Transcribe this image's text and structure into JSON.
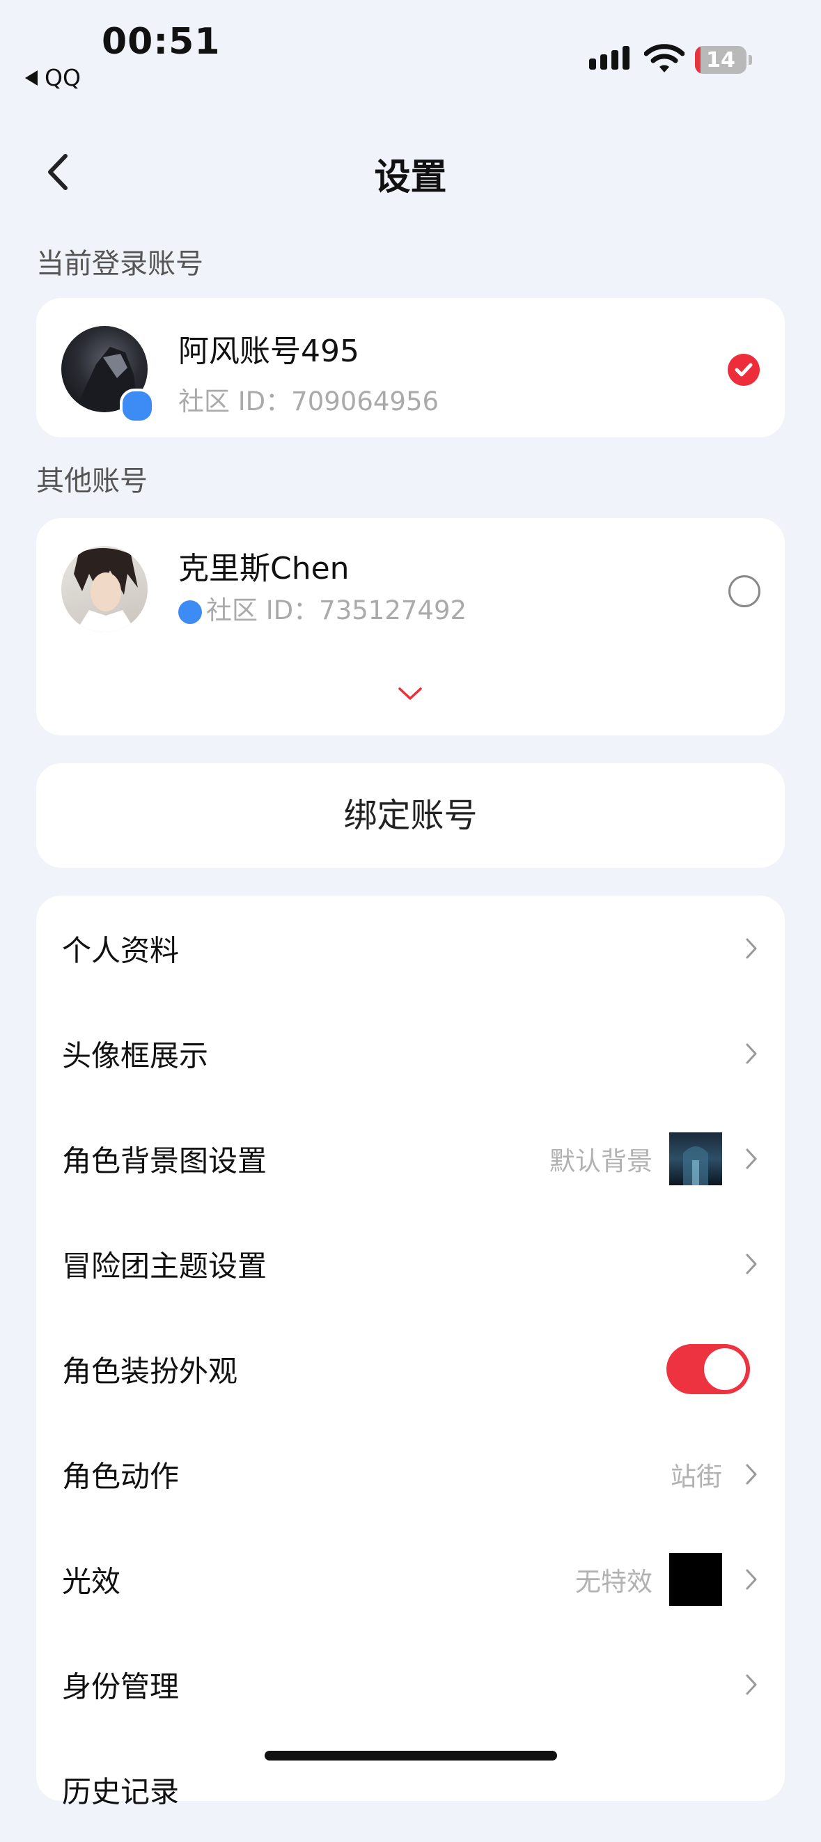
{
  "status_bar": {
    "time": "00:51",
    "back_app": "QQ",
    "battery": "14"
  },
  "header": {
    "title": "设置"
  },
  "current_section": {
    "label": "当前登录账号"
  },
  "current_account": {
    "name": "阿风账号495",
    "id_line": "社区 ID：709064956"
  },
  "other_section": {
    "label": "其他账号"
  },
  "other_account": {
    "name": "克里斯Chen",
    "id_line": "社区 ID：735127492"
  },
  "bind": {
    "label": "绑定账号"
  },
  "settings": [
    {
      "label": "个人资料"
    },
    {
      "label": "头像框展示"
    },
    {
      "label": "角色背景图设置",
      "value": "默认背景"
    },
    {
      "label": "冒险团主题设置"
    },
    {
      "label": "角色装扮外观",
      "toggle": true
    },
    {
      "label": "角色动作",
      "value": "站街"
    },
    {
      "label": "光效",
      "value": "无特效"
    },
    {
      "label": "身份管理"
    },
    {
      "label": "历史记录"
    }
  ],
  "colors": {
    "accent": "#ee2d3a",
    "qq_blue": "#3d8bf5",
    "background": "#f1f3fa"
  }
}
